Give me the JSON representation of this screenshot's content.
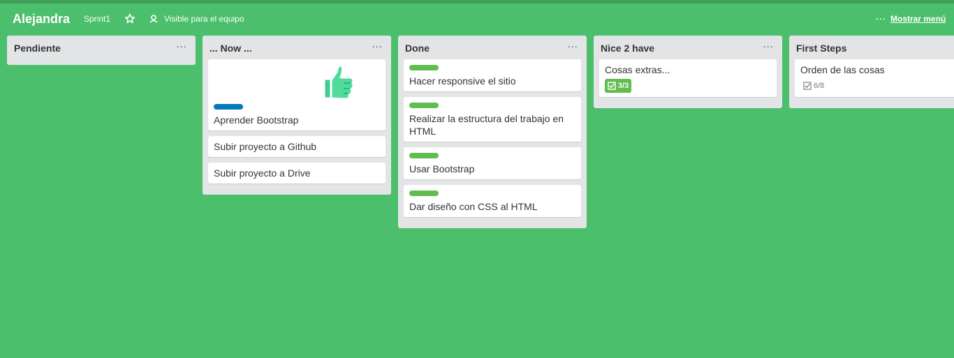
{
  "header": {
    "board_title": "Alejandra",
    "sprint": "Sprint1",
    "visibility": "Visible para el equipo",
    "menu_label": "Mostrar menú"
  },
  "colors": {
    "background": "#4bbf6b",
    "label_green": "#61bd4f",
    "label_blue": "#0079bf"
  },
  "lists": [
    {
      "title": "Pendiente",
      "cards": []
    },
    {
      "title": "... Now ...",
      "cards": [
        {
          "title": "Aprender Bootstrap",
          "label": "blue",
          "sticker": "thumbs-up"
        },
        {
          "title": "Subir proyecto a Github"
        },
        {
          "title": "Subir proyecto a Drive"
        }
      ]
    },
    {
      "title": "Done",
      "cards": [
        {
          "title": "Hacer responsive el sitio",
          "label": "green"
        },
        {
          "title": "Realizar la estructura del trabajo en HTML",
          "label": "green"
        },
        {
          "title": "Usar Bootstrap",
          "label": "green"
        },
        {
          "title": "Dar diseño con CSS al HTML",
          "label": "green"
        }
      ]
    },
    {
      "title": "Nice 2 have",
      "cards": [
        {
          "title": "Cosas extras...",
          "checklist": "3/3",
          "complete": true
        }
      ]
    },
    {
      "title": "First Steps",
      "cards": [
        {
          "title": "Orden de las cosas",
          "checklist": "6/8",
          "complete": false
        }
      ]
    }
  ]
}
